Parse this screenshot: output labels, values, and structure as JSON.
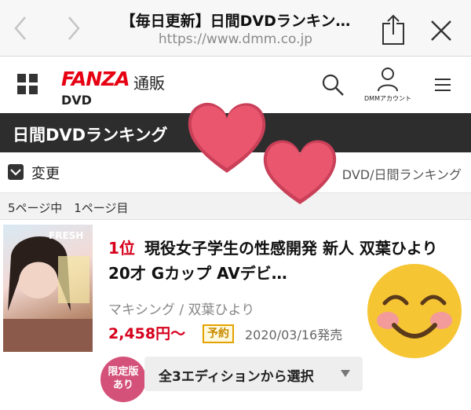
{
  "browser": {
    "title": "【毎日更新】日間DVDランキン…",
    "url": "https://www.dmm.co.jp"
  },
  "header": {
    "logo": "FANZA",
    "logo_sub": "通販",
    "section": "DVD",
    "account_label": "DMMアカウント"
  },
  "ranking_bar": {
    "title": "日間DVDランキング"
  },
  "controls": {
    "change_label": "変更",
    "breadcrumb": "DVD/日間ランキング"
  },
  "pagination": {
    "info": "5ページ中　1ページ目"
  },
  "product": {
    "rank": "1位",
    "title": "現役女子学生の性感開発 新人 双葉ひより20才 Gカップ AVデビ…",
    "maker": "マキシング / 双葉ひより",
    "price": "2,458円〜",
    "badge": "予約",
    "release_date": "2020/03/16発売",
    "limited_badge_line1": "限定版",
    "limited_badge_line2": "あり",
    "edition_select": "全3エディションから選択"
  },
  "colors": {
    "accent_red": "#e60012",
    "rank_red": "#d6001c",
    "dark_bar": "#2d2d2d",
    "heart_pink": "#e9566e",
    "badge_pink": "#d4527a",
    "smiley_yellow": "#f6c534"
  },
  "icons": [
    "back-icon",
    "forward-icon",
    "share-icon",
    "close-icon",
    "menu-grid-icon",
    "search-icon",
    "account-icon",
    "hamburger-icon",
    "checkbox-icon",
    "dropdown-arrow-icon",
    "heart-sticker",
    "smiley-sticker"
  ]
}
